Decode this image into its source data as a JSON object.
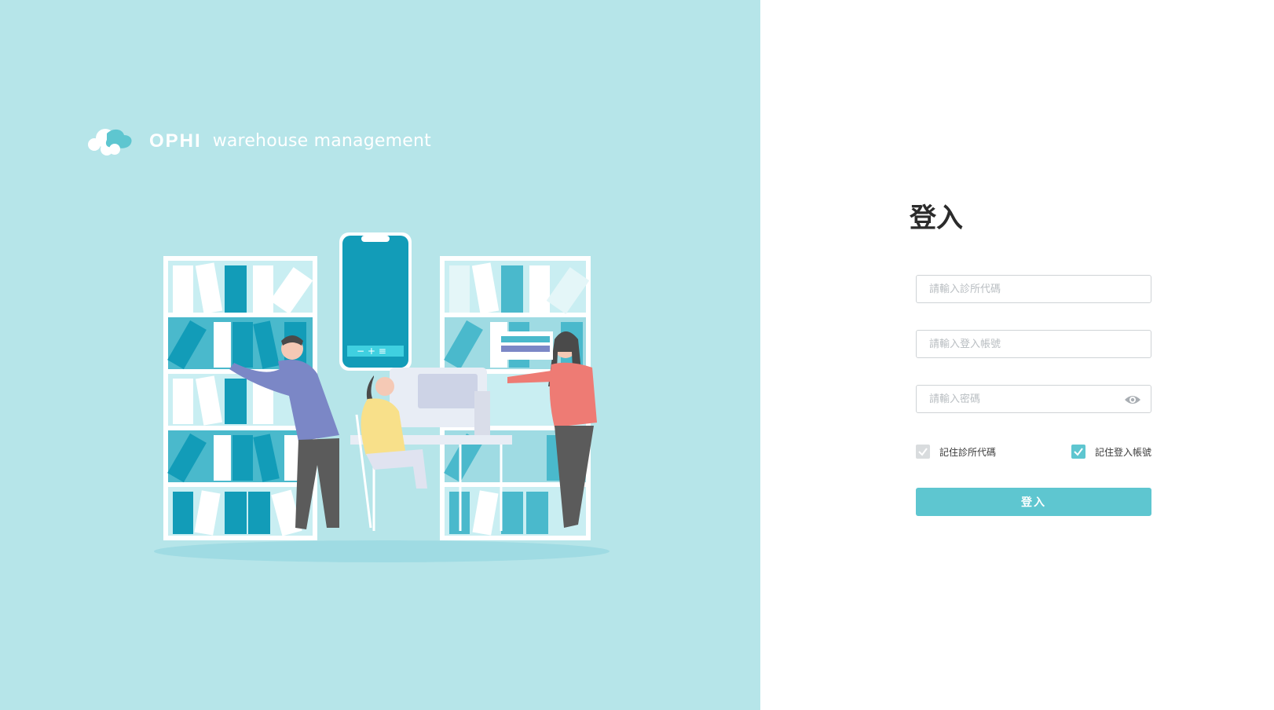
{
  "brand": {
    "name": "OPHI",
    "subtitle": "warehouse management",
    "logo_icon": "cloud-logo-icon",
    "colors": {
      "background": "#b6e5e9",
      "accent": "#5ec6d0",
      "dark_teal": "#129cb8"
    }
  },
  "login": {
    "title": "登入",
    "clinic_code": {
      "placeholder": "請輸入診所代碼",
      "value": ""
    },
    "account": {
      "placeholder": "請輸入登入帳號",
      "value": ""
    },
    "password": {
      "placeholder": "請輸入密碼",
      "value": "",
      "toggle_icon": "eye-icon"
    },
    "remember_clinic": {
      "label": "記住診所代碼",
      "checked": true
    },
    "remember_account": {
      "label": "記住登入帳號",
      "checked": true
    },
    "submit_label": "登入"
  },
  "illustration": {
    "phone_controls": [
      "−",
      "+",
      "≡"
    ]
  }
}
